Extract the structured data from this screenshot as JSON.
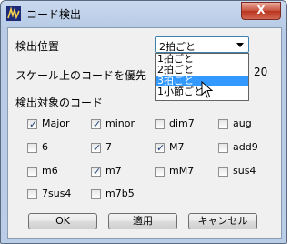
{
  "window": {
    "title": "コード検出",
    "close_label": "X"
  },
  "detect_position": {
    "label": "検出位置",
    "selected": "2拍ごと",
    "options": [
      "1拍ごと",
      "2拍ごと",
      "3拍ごと",
      "1小節ごと"
    ],
    "highlighted": "3拍ごと"
  },
  "priority": {
    "label": "スケール上のコードを優先",
    "value": "20"
  },
  "targets": {
    "label": "検出対象のコード",
    "items": [
      {
        "label": "Major",
        "checked": true
      },
      {
        "label": "minor",
        "checked": true
      },
      {
        "label": "dim7",
        "checked": false
      },
      {
        "label": "aug",
        "checked": false
      },
      {
        "label": "6",
        "checked": false
      },
      {
        "label": "7",
        "checked": true
      },
      {
        "label": "M7",
        "checked": true
      },
      {
        "label": "add9",
        "checked": false
      },
      {
        "label": "m6",
        "checked": false
      },
      {
        "label": "m7",
        "checked": true
      },
      {
        "label": "mM7",
        "checked": false
      },
      {
        "label": "sus4",
        "checked": false
      },
      {
        "label": "7sus4",
        "checked": false
      },
      {
        "label": "m7b5",
        "checked": false
      }
    ]
  },
  "buttons": {
    "ok": "OK",
    "apply": "適用",
    "cancel": "キャンセル"
  }
}
